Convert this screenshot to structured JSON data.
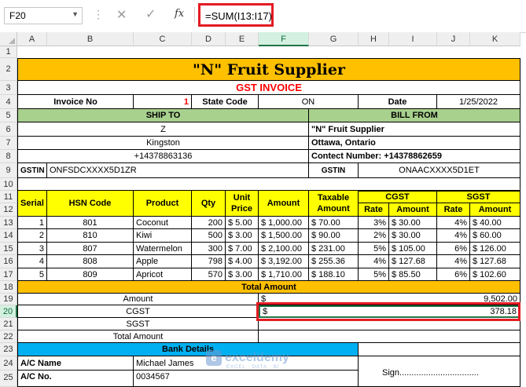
{
  "formula_bar": {
    "name_box": "F20",
    "formula": "=SUM(I13:I17)",
    "cancel_glyph": "✕",
    "confirm_glyph": "✓",
    "fx_label": "fx"
  },
  "columns": [
    "A",
    "B",
    "C",
    "D",
    "E",
    "F",
    "G",
    "H",
    "I",
    "J",
    "K"
  ],
  "rows": [
    "1",
    "2",
    "3",
    "4",
    "5",
    "6",
    "7",
    "8",
    "9",
    "10",
    "11",
    "12",
    "13",
    "14",
    "15",
    "16",
    "17",
    "18",
    "19",
    "20",
    "21",
    "22",
    "23",
    "24",
    "25"
  ],
  "invoice": {
    "company_title": "\"N\" Fruit Supplier",
    "invoice_title": "GST INVOICE",
    "invoice_no_label": "Invoice No",
    "invoice_no": "1",
    "state_code_label": "State Code",
    "state_code": "ON",
    "date_label": "Date",
    "date": "1/25/2022",
    "ship_to_label": "SHIP TO",
    "bill_from_label": "BILL FROM",
    "ship_name": "Z",
    "ship_city": "Kingston",
    "ship_phone": "+14378863136",
    "bill_name": "\"N\" Fruit Supplier",
    "bill_city": "Ottawa, Ontario",
    "bill_contact": "Contect Number: +14378862659",
    "gstin_label": "GSTIN",
    "ship_gstin": "ONFSDCXXXX5D1ZR",
    "bill_gstin": "ONAACXXXX5D1ET"
  },
  "table": {
    "headers": {
      "serial": "Serial",
      "hsn": "HSN Code",
      "product": "Product",
      "qty": "Qty",
      "unit_price": "Unit Price",
      "amount": "Amount",
      "taxable": "Taxable Amount",
      "cgst": "CGST",
      "sgst": "SGST",
      "rate": "Rate",
      "amt": "Amount"
    },
    "rows": [
      {
        "serial": "1",
        "hsn": "801",
        "product": "Coconut",
        "qty": "200",
        "unit": "$ 5.00",
        "amount": "$ 1,000.00",
        "taxable": "$ 70.00",
        "crate": "3%",
        "camt": "$ 30.00",
        "srate": "4%",
        "samt": "$ 40.00"
      },
      {
        "serial": "2",
        "hsn": "810",
        "product": "Kiwi",
        "qty": "500",
        "unit": "$ 3.00",
        "amount": "$ 1,500.00",
        "taxable": "$ 90.00",
        "crate": "2%",
        "camt": "$ 30.00",
        "srate": "4%",
        "samt": "$ 60.00"
      },
      {
        "serial": "3",
        "hsn": "807",
        "product": "Watermelon",
        "qty": "300",
        "unit": "$ 7.00",
        "amount": "$ 2,100.00",
        "taxable": "$ 231.00",
        "crate": "5%",
        "camt": "$ 105.00",
        "srate": "6%",
        "samt": "$ 126.00"
      },
      {
        "serial": "4",
        "hsn": "808",
        "product": "Apple",
        "qty": "798",
        "unit": "$ 4.00",
        "amount": "$ 3,192.00",
        "taxable": "$ 255.36",
        "crate": "4%",
        "camt": "$ 127.68",
        "srate": "4%",
        "samt": "$ 127.68"
      },
      {
        "serial": "5",
        "hsn": "809",
        "product": "Apricot",
        "qty": "570",
        "unit": "$ 3.00",
        "amount": "$ 1,710.00",
        "taxable": "$ 188.10",
        "crate": "5%",
        "camt": "$ 85.50",
        "srate": "6%",
        "samt": "$ 102.60"
      }
    ]
  },
  "totals": {
    "header": "Total Amount",
    "amount_label": "Amount",
    "amount_currency": "$",
    "amount_value": "9,502.00",
    "cgst_label": "CGST",
    "cgst_currency": "$",
    "cgst_value": "378.18",
    "sgst_label": "SGST",
    "total_label": "Total Amount"
  },
  "bank": {
    "header": "Bank Details",
    "ac_name_label": "A/C Name",
    "ac_name": "Michael James",
    "ac_no_label": "A/C No.",
    "ac_no": "0034567",
    "sign_label": "Sign................................."
  },
  "watermark": {
    "logo_glyph": "e",
    "name": "exceldemy",
    "tagline": "EXCEL · DATA · BI"
  },
  "colors": {
    "header_yellow": "#ffff00",
    "title_orange": "#ffc000",
    "ship_green": "#a9d18e",
    "bank_blue": "#00b0f0",
    "highlight_red": "#e31b23"
  }
}
